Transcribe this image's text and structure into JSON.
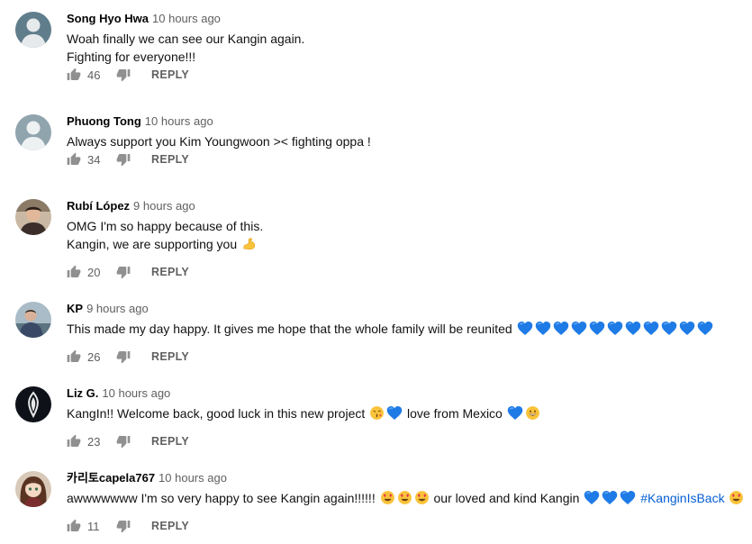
{
  "comments": [
    {
      "author": "Song Hyo Hwa",
      "time": "10 hours ago",
      "avatar": "default-gray",
      "lines": [
        "Woah finally we can see our Kangin again.",
        "Fighting for everyone!!!"
      ],
      "likes": "46",
      "reply_label": "REPLY"
    },
    {
      "author": "Phuong Tong",
      "time": "10 hours ago",
      "avatar": "default-gray-light",
      "lines": [
        "Always support you Kim Youngwoon >< fighting oppa !"
      ],
      "likes": "34",
      "reply_label": "REPLY"
    },
    {
      "author": "Rubí López",
      "time": "9 hours ago",
      "avatar": "photo-person",
      "lines": [
        "OMG I'm so happy because of this.",
        "Kangin, we are supporting you"
      ],
      "line_emojis": [
        [],
        [
          "flexed-biceps"
        ]
      ],
      "likes": "20",
      "reply_label": "REPLY"
    },
    {
      "author": "KP",
      "time": "9 hours ago",
      "avatar": "photo-person-suit",
      "lines": [
        "This made my day happy. It gives me hope that the whole family will be reunited"
      ],
      "line_emojis": [
        [
          "blue-heart",
          "blue-heart",
          "blue-heart",
          "blue-heart",
          "blue-heart",
          "blue-heart",
          "blue-heart",
          "blue-heart",
          "blue-heart",
          "blue-heart",
          "blue-heart"
        ]
      ],
      "likes": "26",
      "reply_label": "REPLY"
    },
    {
      "author": "Liz G.",
      "time": "10 hours ago",
      "avatar": "dark-logo",
      "segments": [
        "KangIn!! Welcome back, good luck in this new project",
        "love from Mexico"
      ],
      "likes": "23",
      "reply_label": "REPLY"
    },
    {
      "author": "카리토capela767",
      "time": "10 hours ago",
      "avatar": "anime-girl",
      "segments": [
        "awwwwwww I'm so very happy to see Kangin again!!!!!!",
        "our loved and kind Kangin",
        "#KanginIsBack"
      ],
      "likes": "11",
      "reply_label": "REPLY"
    }
  ],
  "colors": {
    "author": "#030303",
    "meta": "#606060",
    "hashtag": "#065fd4",
    "blue_heart": "#1e7be6",
    "emoji_yellow": "#f9c33a"
  },
  "icons": {
    "like": "thumbs-up-icon",
    "dislike": "thumbs-down-icon"
  }
}
